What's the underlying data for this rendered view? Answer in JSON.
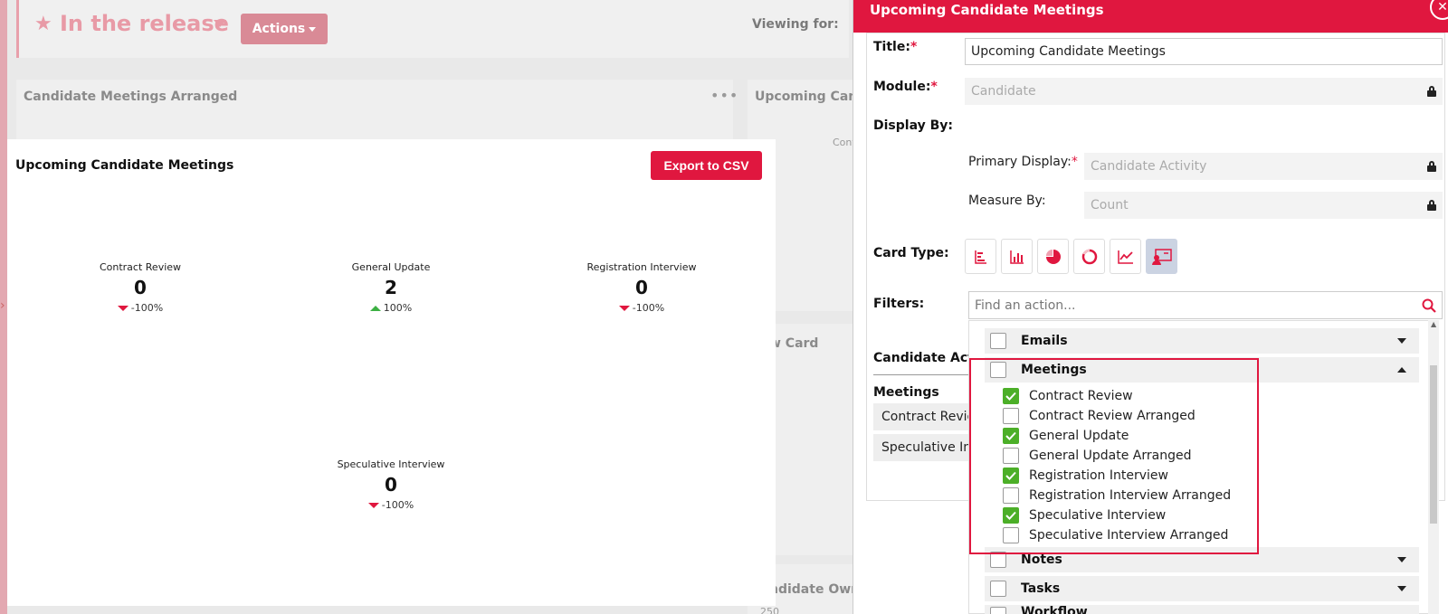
{
  "background": {
    "release_title": "In the release",
    "actions_label": "Actions",
    "viewing_for_label": "Viewing for:",
    "card1_title": "Candidate Meetings Arranged",
    "card2_title": "Upcoming Cand",
    "card3_title": "w Card",
    "card4_title": "ndidate Own",
    "mini_cont": "Cont",
    "mini_250": "250"
  },
  "modal": {
    "title": "Upcoming Candidate Meetings",
    "export_label": "Export to CSV",
    "stats": [
      {
        "label": "Contract Review",
        "value": "0",
        "change": "-100%",
        "direction": "down"
      },
      {
        "label": "General Update",
        "value": "2",
        "change": "100%",
        "direction": "up"
      },
      {
        "label": "Registration Interview",
        "value": "0",
        "change": "-100%",
        "direction": "down"
      },
      {
        "label": "Speculative Interview",
        "value": "0",
        "change": "-100%",
        "direction": "down"
      }
    ]
  },
  "panel": {
    "header_title": "Upcoming Candidate Meetings",
    "close_icon": "✕",
    "title_label": "Title:",
    "title_value": "Upcoming Candidate Meetings",
    "module_label": "Module:",
    "module_value": "Candidate",
    "display_by_label": "Display By:",
    "primary_display_label": "Primary Display:",
    "primary_display_value": "Candidate Activity",
    "measure_by_label": "Measure By:",
    "measure_by_value": "Count",
    "card_type_label": "Card Type:",
    "card_types": [
      "horizontal-bar-chart-icon",
      "vertical-bar-chart-icon",
      "pie-chart-icon",
      "donut-chart-icon",
      "line-chart-icon",
      "presentation-icon"
    ],
    "filters_label": "Filters:",
    "filters_placeholder": "Find an action...",
    "candidate_activity_label": "Candidate Activ",
    "meetings_label": "Meetings",
    "chips": [
      "Contract Revie",
      "Speculative Int"
    ],
    "required_mark": "*"
  },
  "dropdown": {
    "groups": [
      {
        "label": "Emails",
        "expanded": false
      },
      {
        "label": "Meetings",
        "expanded": true
      },
      {
        "label": "Notes",
        "expanded": false
      },
      {
        "label": "Tasks",
        "expanded": false
      },
      {
        "label": "Workflow",
        "expanded": false
      }
    ],
    "meeting_options": [
      {
        "label": "Contract Review",
        "checked": true
      },
      {
        "label": "Contract Review Arranged",
        "checked": false
      },
      {
        "label": "General Update",
        "checked": true
      },
      {
        "label": "General Update Arranged",
        "checked": false
      },
      {
        "label": "Registration Interview",
        "checked": true
      },
      {
        "label": "Registration Interview Arranged",
        "checked": false
      },
      {
        "label": "Speculative Interview",
        "checked": true
      },
      {
        "label": "Speculative Interview Arranged",
        "checked": false
      }
    ]
  },
  "colors": {
    "brand": "#e0173f",
    "check": "#4caf28",
    "up": "#3cb043"
  }
}
